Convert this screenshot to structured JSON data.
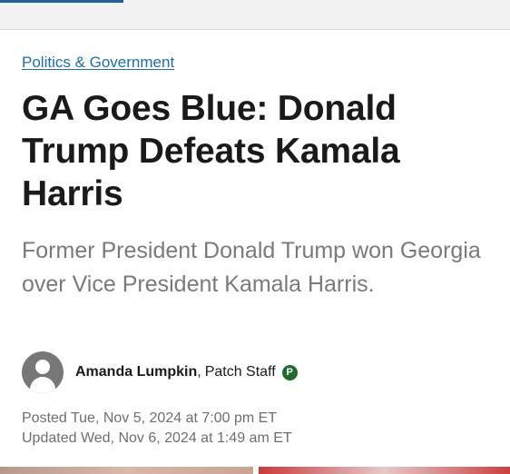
{
  "article": {
    "category": "Politics & Government",
    "headline": "GA Goes Blue: Donald Trump Defeats Kamala Harris",
    "subhead": "Former President Donald Trump won Georgia over Vice President Kamala Harris.",
    "author": {
      "name": "Amanda Lumpkin",
      "separator": ",",
      "role": "Patch Staff",
      "badge": "P",
      "avatar_icon": "user-avatar-icon"
    },
    "posted": "Posted Tue, Nov 5, 2024 at 7:00 pm ET",
    "updated": "Updated Wed, Nov 6, 2024 at 1:49 am ET"
  },
  "colors": {
    "link": "#1a6fb0",
    "badge": "#1f6b2e",
    "muted_text": "#7a7a7a"
  }
}
